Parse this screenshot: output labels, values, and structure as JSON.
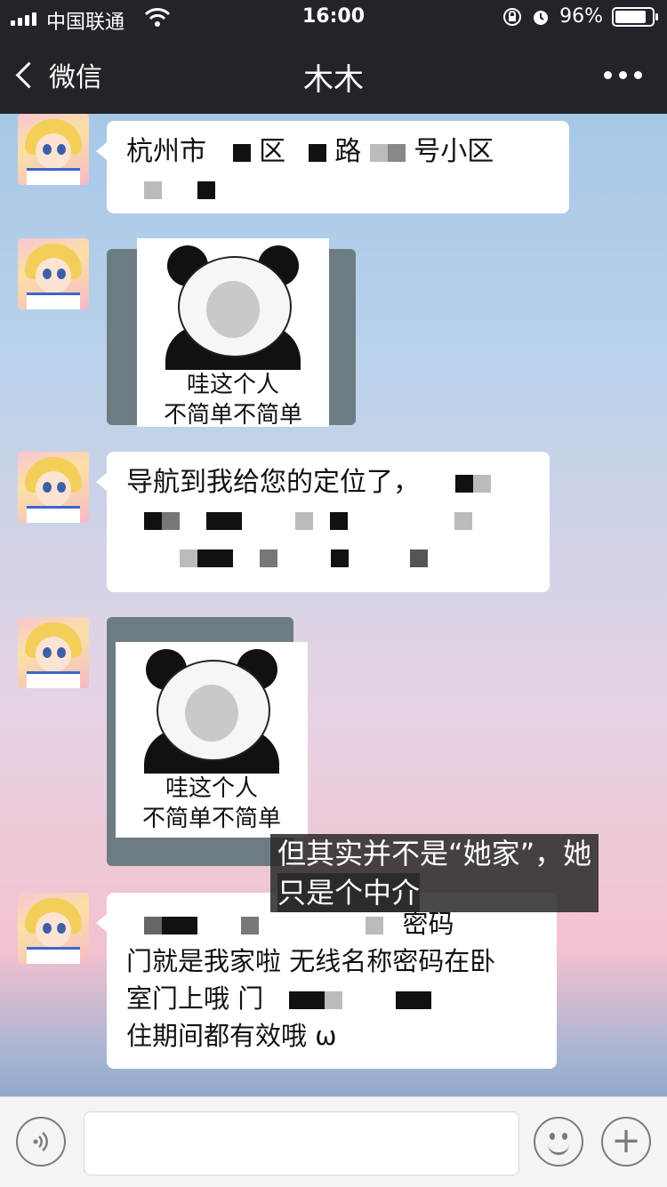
{
  "status_bar": {
    "carrier": "中国联通",
    "time": "16:00",
    "battery": "96%",
    "battery_level": 0.96
  },
  "nav": {
    "back_label": "微信",
    "title": "木木",
    "more_icon": "more-dots-icon"
  },
  "messages": [
    {
      "type": "text",
      "visible_text": [
        "杭州市",
        "区",
        "路",
        "号小区"
      ]
    },
    {
      "type": "sticker",
      "caption_line1": "哇这个人",
      "caption_line2": "不简单不简单"
    },
    {
      "type": "text",
      "visible_text": [
        "导航到我给您的定位了，"
      ]
    },
    {
      "type": "sticker",
      "caption_line1": "哇这个人",
      "caption_line2": "不简单不简单"
    },
    {
      "type": "text",
      "visible_text": [
        "密码",
        "门就是我家啦 无线名称密码在卧",
        "室门上哦 门",
        "住期间都有效哦",
        "ω"
      ]
    }
  ],
  "overlay_caption": {
    "line1": "但其实并不是“她家”，她",
    "line2": "只是个中介"
  },
  "input_bar": {
    "voice_icon": "voice-icon",
    "emoji_icon": "emoji-icon",
    "plus_icon": "plus-icon"
  }
}
